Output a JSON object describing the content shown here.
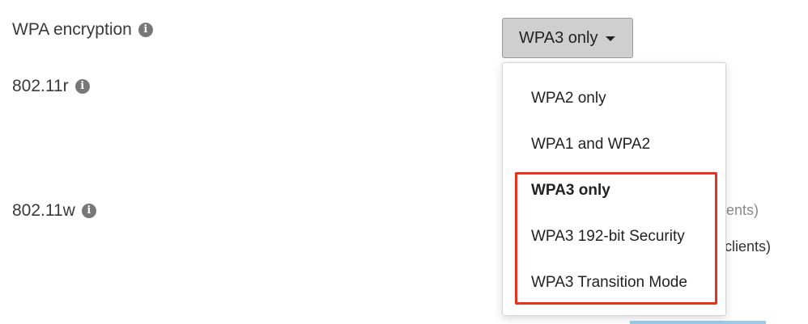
{
  "settings": {
    "wpa_encryption_label": "WPA encryption",
    "r80211_label": "802.11r",
    "w80211_label": "802.11w"
  },
  "select": {
    "value": "WPA3 only",
    "options": [
      "WPA2 only",
      "WPA1 and WPA2",
      "WPA3 only",
      "WPA3 192-bit Security",
      "WPA3 Transition Mode"
    ],
    "selected_index": 2
  },
  "background": {
    "fragment_1": "clients)",
    "fragment_2": "d clients)"
  },
  "annotation": {
    "highlight_color": "#e8321e"
  },
  "icons": {
    "info": "info-icon",
    "caret": "chevron-down-icon"
  }
}
